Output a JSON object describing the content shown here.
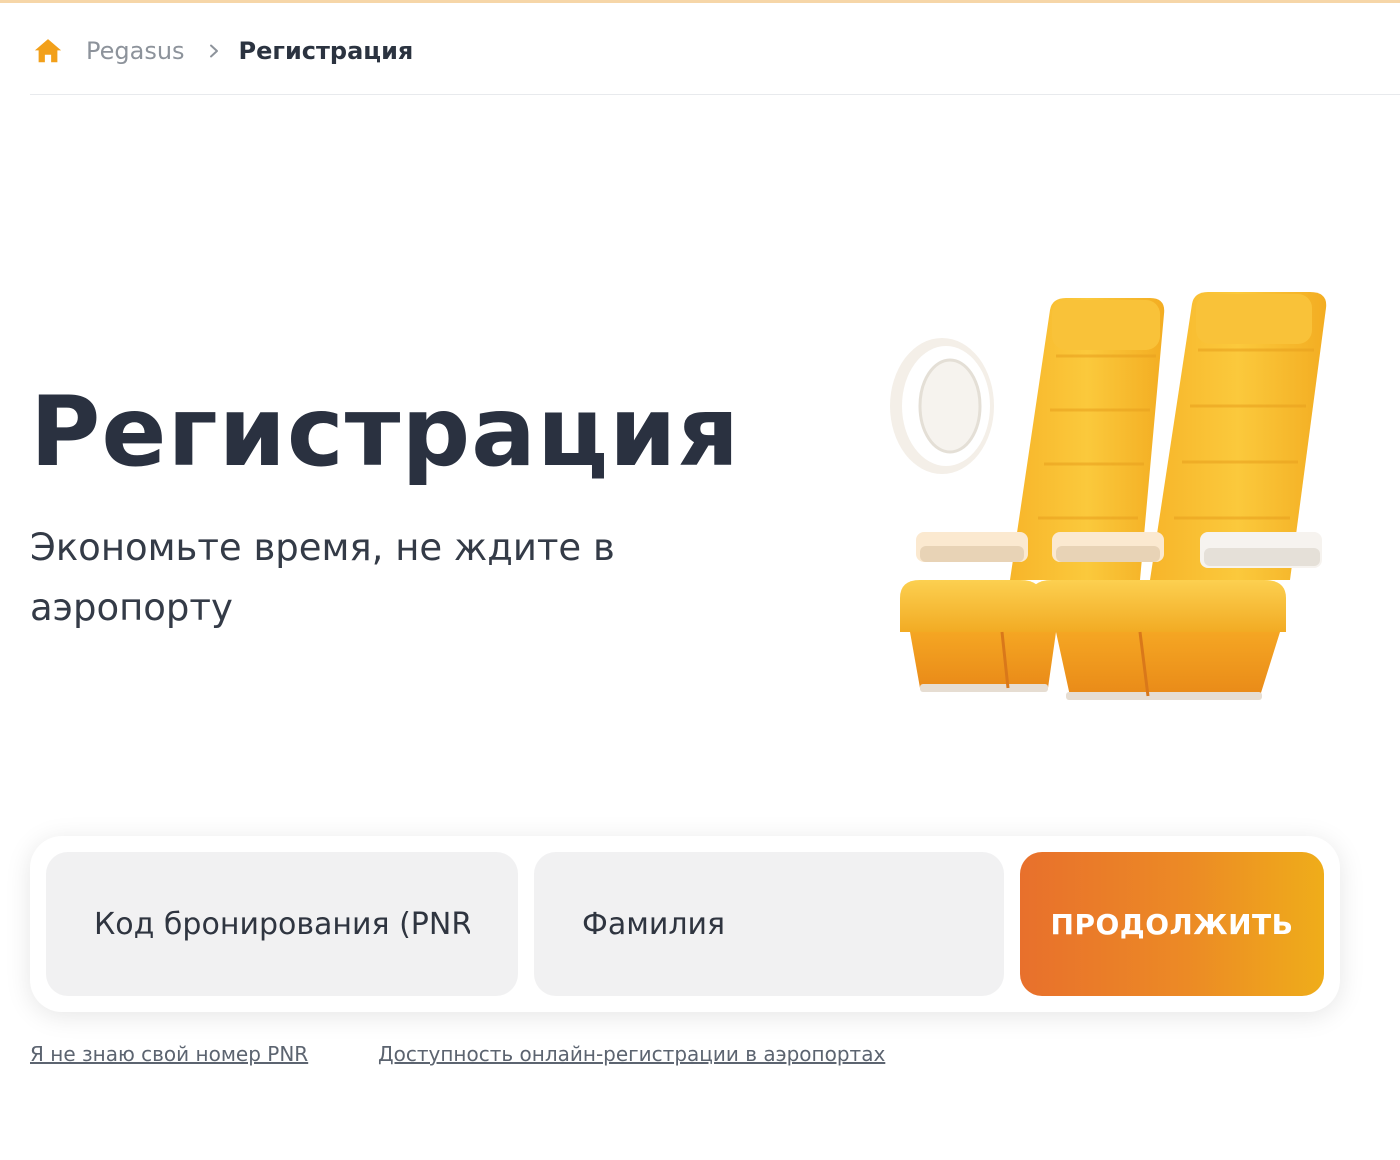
{
  "breadcrumb": {
    "home_icon": "home-icon",
    "root_label": "Pegasus",
    "separator_icon": "chevron-right-icon",
    "current_label": "Регистрация"
  },
  "hero": {
    "title": "Регистрация",
    "subtitle": "Экономьте время, не ждите в аэропорту",
    "illustration": "airplane-seats-with-window"
  },
  "form": {
    "pnr_placeholder": "Код бронирования (PNR)",
    "pnr_value": "",
    "surname_placeholder": "Фамилия",
    "surname_value": "",
    "submit_label": "ПРОДОЛЖИТЬ"
  },
  "links": {
    "unknown_pnr": "Я не знаю свой номер PNR",
    "airport_availability": "Доступность онлайн-регистрации в аэропортах"
  },
  "colors": {
    "accent_orange": "#e8702c",
    "accent_yellow": "#efad1a",
    "home_icon": "#f2a01a",
    "text_dark": "#2a3140",
    "field_bg": "#f1f1f2"
  }
}
